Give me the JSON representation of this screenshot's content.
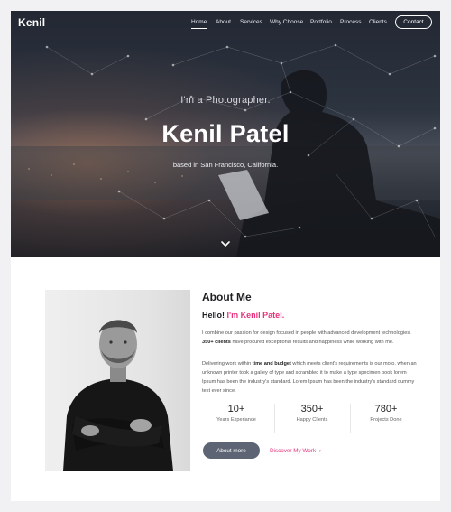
{
  "nav": {
    "logo": "Kenil",
    "items": [
      {
        "label": "Home",
        "active": true
      },
      {
        "label": "About"
      },
      {
        "label": "Services"
      },
      {
        "label": "Why Choose"
      },
      {
        "label": "Portfolio"
      },
      {
        "label": "Process"
      },
      {
        "label": "Clients"
      }
    ],
    "contact": "Contact"
  },
  "hero": {
    "subtitle": "I'm a Photographer.",
    "name": "Kenil Patel",
    "location": "based in San Francisco, California."
  },
  "about": {
    "heading": "About Me",
    "hello_prefix": "Hello!",
    "hello_name": "I'm Kenil Patel.",
    "p1_a": "I combine our passion for design focused in people with advanced development technologies.",
    "p1_b": "350+ clients",
    "p1_c": "have procured exceptional results and happiness while working with me.",
    "p2_a": "Delivering work within",
    "p2_b": "time and budget",
    "p2_c": "which meets client's requirements is our moto. when an unknown printer took a galley of type and scrambled it to make a type specimen book lorem Ipsum has been the industry's standard. Lorem Ipsum has been the industry's standard dummy text ever since.",
    "stats": [
      {
        "value": "10+",
        "label": "Years Experiance"
      },
      {
        "value": "350+",
        "label": "Happy Clients"
      },
      {
        "value": "780+",
        "label": "Projects Done"
      }
    ],
    "btn_about": "About more",
    "btn_discover": "Discover My Work"
  },
  "colors": {
    "accent": "#e8327c",
    "button": "#5d6473"
  }
}
